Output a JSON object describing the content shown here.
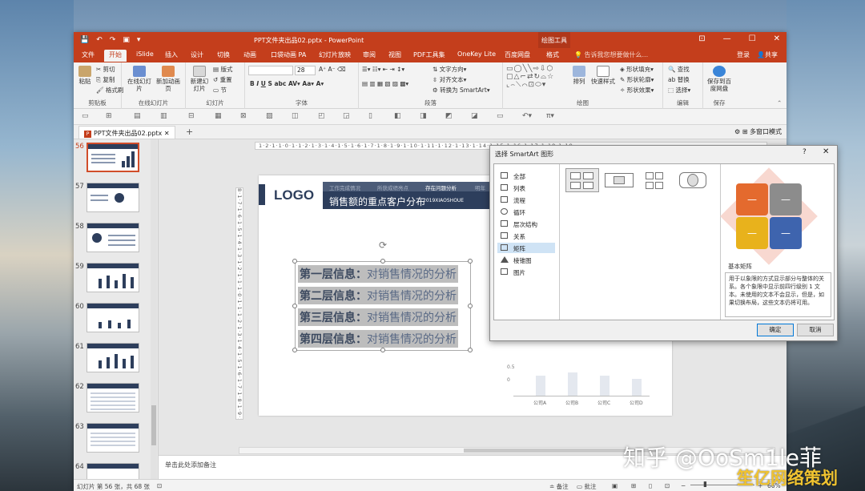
{
  "app": {
    "qat": [
      "💾",
      "↶",
      "↷",
      "▣",
      "▾"
    ],
    "title": "PPT文件夹出品02.pptx - PowerPoint",
    "contextual_title": "绘图工具",
    "window_buttons": [
      "⊡",
      "—",
      "☐",
      "✕"
    ]
  },
  "tabs": {
    "items": [
      {
        "label": "文件",
        "active": false
      },
      {
        "label": "开始",
        "active": true
      },
      {
        "label": "iSlide",
        "active": false
      },
      {
        "label": "插入",
        "active": false
      },
      {
        "label": "设计",
        "active": false
      },
      {
        "label": "切换",
        "active": false
      },
      {
        "label": "动画",
        "active": false
      },
      {
        "label": "口袋动画 PA",
        "active": false
      },
      {
        "label": "幻灯片放映",
        "active": false
      },
      {
        "label": "审阅",
        "active": false
      },
      {
        "label": "视图",
        "active": false
      },
      {
        "label": "PDF工具集",
        "active": false
      },
      {
        "label": "OneKey Lite",
        "active": false
      },
      {
        "label": "百度网盘",
        "active": false
      },
      {
        "label": "格式",
        "active": false
      }
    ],
    "tellme": "告诉我您想要做什么...",
    "signin": "登录",
    "share": "共享"
  },
  "ribbon": {
    "clipboard": {
      "paste": "粘贴",
      "cut": "剪切",
      "copy": "复制",
      "format_painter": "格式刷",
      "label": "剪贴板"
    },
    "online_slides": {
      "online": "在线幻灯片",
      "new_anim": "新加动画页",
      "label": "在线幻灯片"
    },
    "slides": {
      "new": "新建幻灯片",
      "layout": "版式",
      "reset": "重置",
      "section": "节",
      "label": "幻灯片"
    },
    "font": {
      "name": "",
      "size": "28",
      "label": "字体"
    },
    "paragraph": {
      "text_dir": "文字方向",
      "align_text": "对齐文本",
      "to_smartart": "转换为 SmartArt",
      "label": "段落"
    },
    "drawing": {
      "arrange": "排列",
      "quick_styles": "快速样式",
      "fill": "形状填充",
      "outline": "形状轮廓",
      "effects": "形状效果",
      "label": "绘图"
    },
    "editing": {
      "find": "查找",
      "replace": "替换",
      "select": "选择",
      "label": "编辑"
    },
    "save": {
      "save_to": "保存到百度网盘",
      "label": "保存"
    }
  },
  "doc_tab": {
    "label": "PPT文件夹出品02.pptx",
    "multi_window": "多窗口模式"
  },
  "thumbnails": [
    {
      "num": "56",
      "selected": true
    },
    {
      "num": "57",
      "selected": false
    },
    {
      "num": "58",
      "selected": false
    },
    {
      "num": "59",
      "selected": false
    },
    {
      "num": "60",
      "selected": false
    },
    {
      "num": "61",
      "selected": false
    },
    {
      "num": "62",
      "selected": false
    },
    {
      "num": "63",
      "selected": false
    },
    {
      "num": "64",
      "selected": false
    }
  ],
  "rulers": {
    "h": "1·2·1·1·0·1·1·2·1·3·1·4·1·5·1·6·1·7·1·8·1·9·1·10·1·11·1·12·1·13·1·14·1·15·1·16·1·17·1·18·1·19",
    "v": "8·1·7·1·6·1·5·1·4·1·3·1·2·1·1·1·0·1·1·1·2·1·3·1·4·1·5·1·6·1·7·1·8·1·9·1·10·1·11·1·12"
  },
  "slide": {
    "logo": "LOGO",
    "nav": [
      "工作完成情况",
      "所获成绩亮点",
      "存在问题分析",
      "明年"
    ],
    "title": "销售额的重点客户分布",
    "subtitle": "2019XIAOSHOUE",
    "rows": [
      {
        "bold": "第一层信息：",
        "rest": "对销售情况的分析"
      },
      {
        "bold": "第二层信息：",
        "rest": "对销售情况的分析"
      },
      {
        "bold": "第三层信息：",
        "rest": "对销售情况的分析"
      },
      {
        "bold": "第四层信息：",
        "rest": "对销售情况的分析"
      }
    ],
    "chart": {
      "y_ticks": [
        "0.5",
        "0"
      ],
      "categories": [
        "公司A",
        "公司B",
        "公司C",
        "公司D"
      ]
    }
  },
  "notes": "单击此处添加备注",
  "status": {
    "slide_count": "幻灯片 第 56 张，共 68 张",
    "notes_btn": "备注",
    "comments_btn": "批注",
    "zoom": "66%"
  },
  "dialog": {
    "title": "选择 SmartArt 图形",
    "help": "?",
    "close": "✕",
    "categories": [
      {
        "label": "全部",
        "selected": false
      },
      {
        "label": "列表",
        "selected": false
      },
      {
        "label": "流程",
        "selected": false
      },
      {
        "label": "循环",
        "selected": false
      },
      {
        "label": "层次结构",
        "selected": false
      },
      {
        "label": "关系",
        "selected": false
      },
      {
        "label": "矩阵",
        "selected": true
      },
      {
        "label": "棱锥图",
        "selected": false
      },
      {
        "label": "图片",
        "selected": false
      }
    ],
    "preview_name": "基本矩阵",
    "preview_desc": "用于以象限的方式显示部分与整体的关系。各个象限中显示前四行级别 1 文本。未使用的文本不会显示，但是，如果切换布局，这些文本仍将可用。",
    "matrix_colors": [
      "#e46a2e",
      "#8c8c8c",
      "#e8b21c",
      "#3e64ae"
    ],
    "ok": "确定",
    "cancel": "取消"
  },
  "watermark": {
    "main": "知乎 @OoSm1le菲",
    "sub": "笙亿网络策划"
  }
}
